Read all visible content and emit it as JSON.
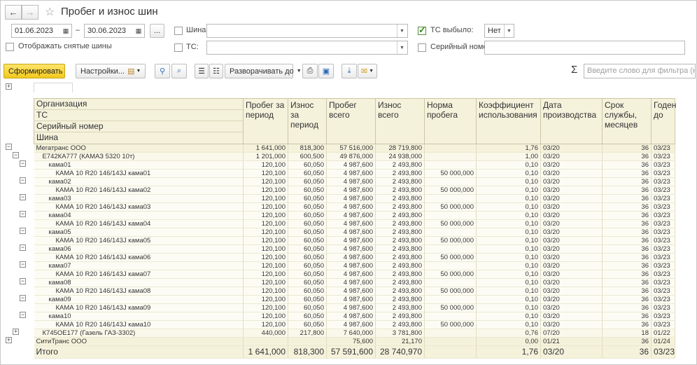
{
  "window": {
    "title": "Пробег и износ шин"
  },
  "filters": {
    "date_from": "01.06.2023",
    "date_to": "30.06.2023",
    "dash": "–",
    "ellipsis": "...",
    "tire_label": "Шина:",
    "tire_value": "",
    "vehicle_label": "ТС:",
    "vehicle_value": "",
    "show_removed_label": "Отображать снятые шины",
    "retired_label": "ТС выбыло:",
    "retired_value": "Нет",
    "serial_label": "Серийный номер:",
    "serial_value": ""
  },
  "toolbar": {
    "generate": "Сформировать",
    "settings": "Настройки...",
    "expand": "Разворачивать до",
    "search_placeholder": "Введите слово для фильтра (названи"
  },
  "table": {
    "group_headers": [
      "Организация",
      "ТС",
      "Серийный номер",
      "Шина"
    ],
    "columns": [
      "Пробег за период",
      "Износ за период",
      "Пробег всего",
      "Износ всего",
      "Норма пробега",
      "Коэффициент использования",
      "Дата производства",
      "Срок службы, месяцев",
      "Годен до"
    ],
    "rows": [
      {
        "level": 0,
        "name": "Мегатранс ООО",
        "vals": [
          "1 641,000",
          "818,300",
          "57 516,000",
          "28 719,800",
          "",
          "1,76",
          "03/20",
          "36",
          "03/23"
        ]
      },
      {
        "level": 1,
        "name": "Е742КА777 (КАМАЗ 5320 10т)",
        "vals": [
          "1 201,000",
          "600,500",
          "49 876,000",
          "24 938,000",
          "",
          "1,00",
          "03/20",
          "36",
          "03/23"
        ]
      },
      {
        "level": 2,
        "name": "кама01",
        "vals": [
          "120,100",
          "60,050",
          "4 987,600",
          "2 493,800",
          "",
          "0,10",
          "03/20",
          "36",
          "03/23"
        ]
      },
      {
        "level": 3,
        "name": "КАМА 10 R20 146/143J кама01",
        "vals": [
          "120,100",
          "60,050",
          "4 987,600",
          "2 493,800",
          "50 000,000",
          "0,10",
          "03/20",
          "36",
          "03/23"
        ]
      },
      {
        "level": 2,
        "name": "кама02",
        "vals": [
          "120,100",
          "60,050",
          "4 987,600",
          "2 493,800",
          "",
          "0,10",
          "03/20",
          "36",
          "03/23"
        ]
      },
      {
        "level": 3,
        "name": "КАМА 10 R20 146/143J кама02",
        "vals": [
          "120,100",
          "60,050",
          "4 987,600",
          "2 493,800",
          "50 000,000",
          "0,10",
          "03/20",
          "36",
          "03/23"
        ]
      },
      {
        "level": 2,
        "name": "кама03",
        "vals": [
          "120,100",
          "60,050",
          "4 987,600",
          "2 493,800",
          "",
          "0,10",
          "03/20",
          "36",
          "03/23"
        ]
      },
      {
        "level": 3,
        "name": "КАМА 10 R20 146/143J кама03",
        "vals": [
          "120,100",
          "60,050",
          "4 987,600",
          "2 493,800",
          "50 000,000",
          "0,10",
          "03/20",
          "36",
          "03/23"
        ]
      },
      {
        "level": 2,
        "name": "кама04",
        "vals": [
          "120,100",
          "60,050",
          "4 987,600",
          "2 493,800",
          "",
          "0,10",
          "03/20",
          "36",
          "03/23"
        ]
      },
      {
        "level": 3,
        "name": "КАМА 10 R20 146/143J кама04",
        "vals": [
          "120,100",
          "60,050",
          "4 987,600",
          "2 493,800",
          "50 000,000",
          "0,10",
          "03/20",
          "36",
          "03/23"
        ]
      },
      {
        "level": 2,
        "name": "кама05",
        "vals": [
          "120,100",
          "60,050",
          "4 987,600",
          "2 493,800",
          "",
          "0,10",
          "03/20",
          "36",
          "03/23"
        ]
      },
      {
        "level": 3,
        "name": "КАМА 10 R20 146/143J кама05",
        "vals": [
          "120,100",
          "60,050",
          "4 987,600",
          "2 493,800",
          "50 000,000",
          "0,10",
          "03/20",
          "36",
          "03/23"
        ]
      },
      {
        "level": 2,
        "name": "кама06",
        "vals": [
          "120,100",
          "60,050",
          "4 987,600",
          "2 493,800",
          "",
          "0,10",
          "03/20",
          "36",
          "03/23"
        ]
      },
      {
        "level": 3,
        "name": "КАМА 10 R20 146/143J кама06",
        "vals": [
          "120,100",
          "60,050",
          "4 987,600",
          "2 493,800",
          "50 000,000",
          "0,10",
          "03/20",
          "36",
          "03/23"
        ]
      },
      {
        "level": 2,
        "name": "кама07",
        "vals": [
          "120,100",
          "60,050",
          "4 987,600",
          "2 493,800",
          "",
          "0,10",
          "03/20",
          "36",
          "03/23"
        ]
      },
      {
        "level": 3,
        "name": "КАМА 10 R20 146/143J кама07",
        "vals": [
          "120,100",
          "60,050",
          "4 987,600",
          "2 493,800",
          "50 000,000",
          "0,10",
          "03/20",
          "36",
          "03/23"
        ]
      },
      {
        "level": 2,
        "name": "кама08",
        "vals": [
          "120,100",
          "60,050",
          "4 987,600",
          "2 493,800",
          "",
          "0,10",
          "03/20",
          "36",
          "03/23"
        ]
      },
      {
        "level": 3,
        "name": "КАМА 10 R20 146/143J кама08",
        "vals": [
          "120,100",
          "60,050",
          "4 987,600",
          "2 493,800",
          "50 000,000",
          "0,10",
          "03/20",
          "36",
          "03/23"
        ]
      },
      {
        "level": 2,
        "name": "кама09",
        "vals": [
          "120,100",
          "60,050",
          "4 987,600",
          "2 493,800",
          "",
          "0,10",
          "03/20",
          "36",
          "03/23"
        ]
      },
      {
        "level": 3,
        "name": "КАМА 10 R20 146/143J кама09",
        "vals": [
          "120,100",
          "60,050",
          "4 987,600",
          "2 493,800",
          "50 000,000",
          "0,10",
          "03/20",
          "36",
          "03/23"
        ]
      },
      {
        "level": 2,
        "name": "кама10",
        "vals": [
          "120,100",
          "60,050",
          "4 987,600",
          "2 493,800",
          "",
          "0,10",
          "03/20",
          "36",
          "03/23"
        ]
      },
      {
        "level": 3,
        "name": "КАМА 10 R20 146/143J кама10",
        "vals": [
          "120,100",
          "60,050",
          "4 987,600",
          "2 493,800",
          "50 000,000",
          "0,10",
          "03/20",
          "36",
          "03/23"
        ]
      },
      {
        "level": 1,
        "name": "К745ОЕ177 (Газель ГАЗ-3302)",
        "vals": [
          "440,000",
          "217,800",
          "7 640,000",
          "3 781,800",
          "",
          "0,76",
          "07/20",
          "18",
          "01/22"
        ]
      },
      {
        "level": 0,
        "name": "СитиТранс ООО",
        "vals": [
          "",
          "",
          "75,600",
          "21,170",
          "",
          "0,00",
          "01/21",
          "36",
          "01/24"
        ]
      }
    ],
    "total": {
      "name": "Итого",
      "vals": [
        "1 641,000",
        "818,300",
        "57 591,600",
        "28 740,970",
        "",
        "1,76",
        "03/20",
        "36",
        "03/23"
      ]
    }
  }
}
